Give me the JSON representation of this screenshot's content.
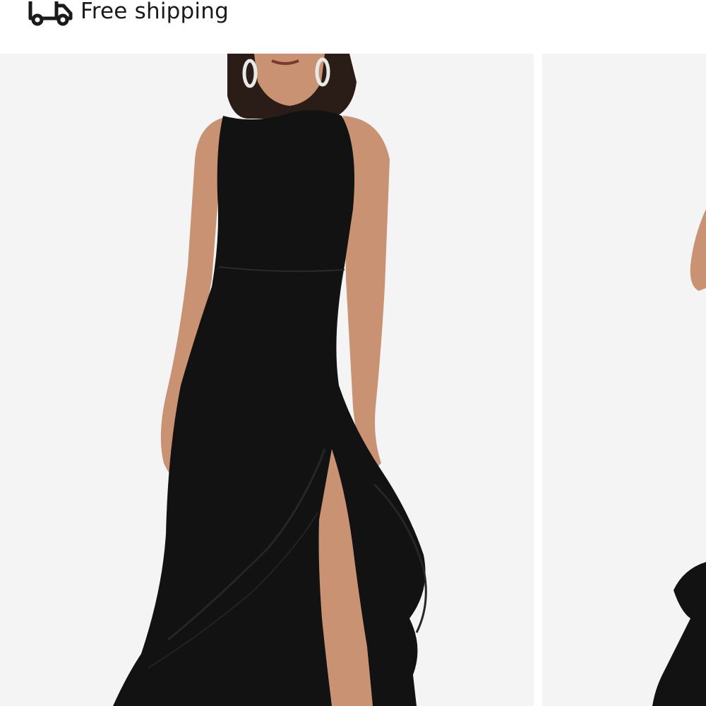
{
  "shipping": {
    "label": "Free shipping",
    "icon": "truck-icon"
  },
  "gallery": {
    "images": [
      {
        "alt": "product-image"
      },
      {
        "alt": "product-image"
      }
    ]
  },
  "colors": {
    "background": "#ffffff",
    "image_bg": "#f4f4f4",
    "dress": "#121212",
    "skin": "#c99373",
    "text": "#1a1a1a"
  }
}
